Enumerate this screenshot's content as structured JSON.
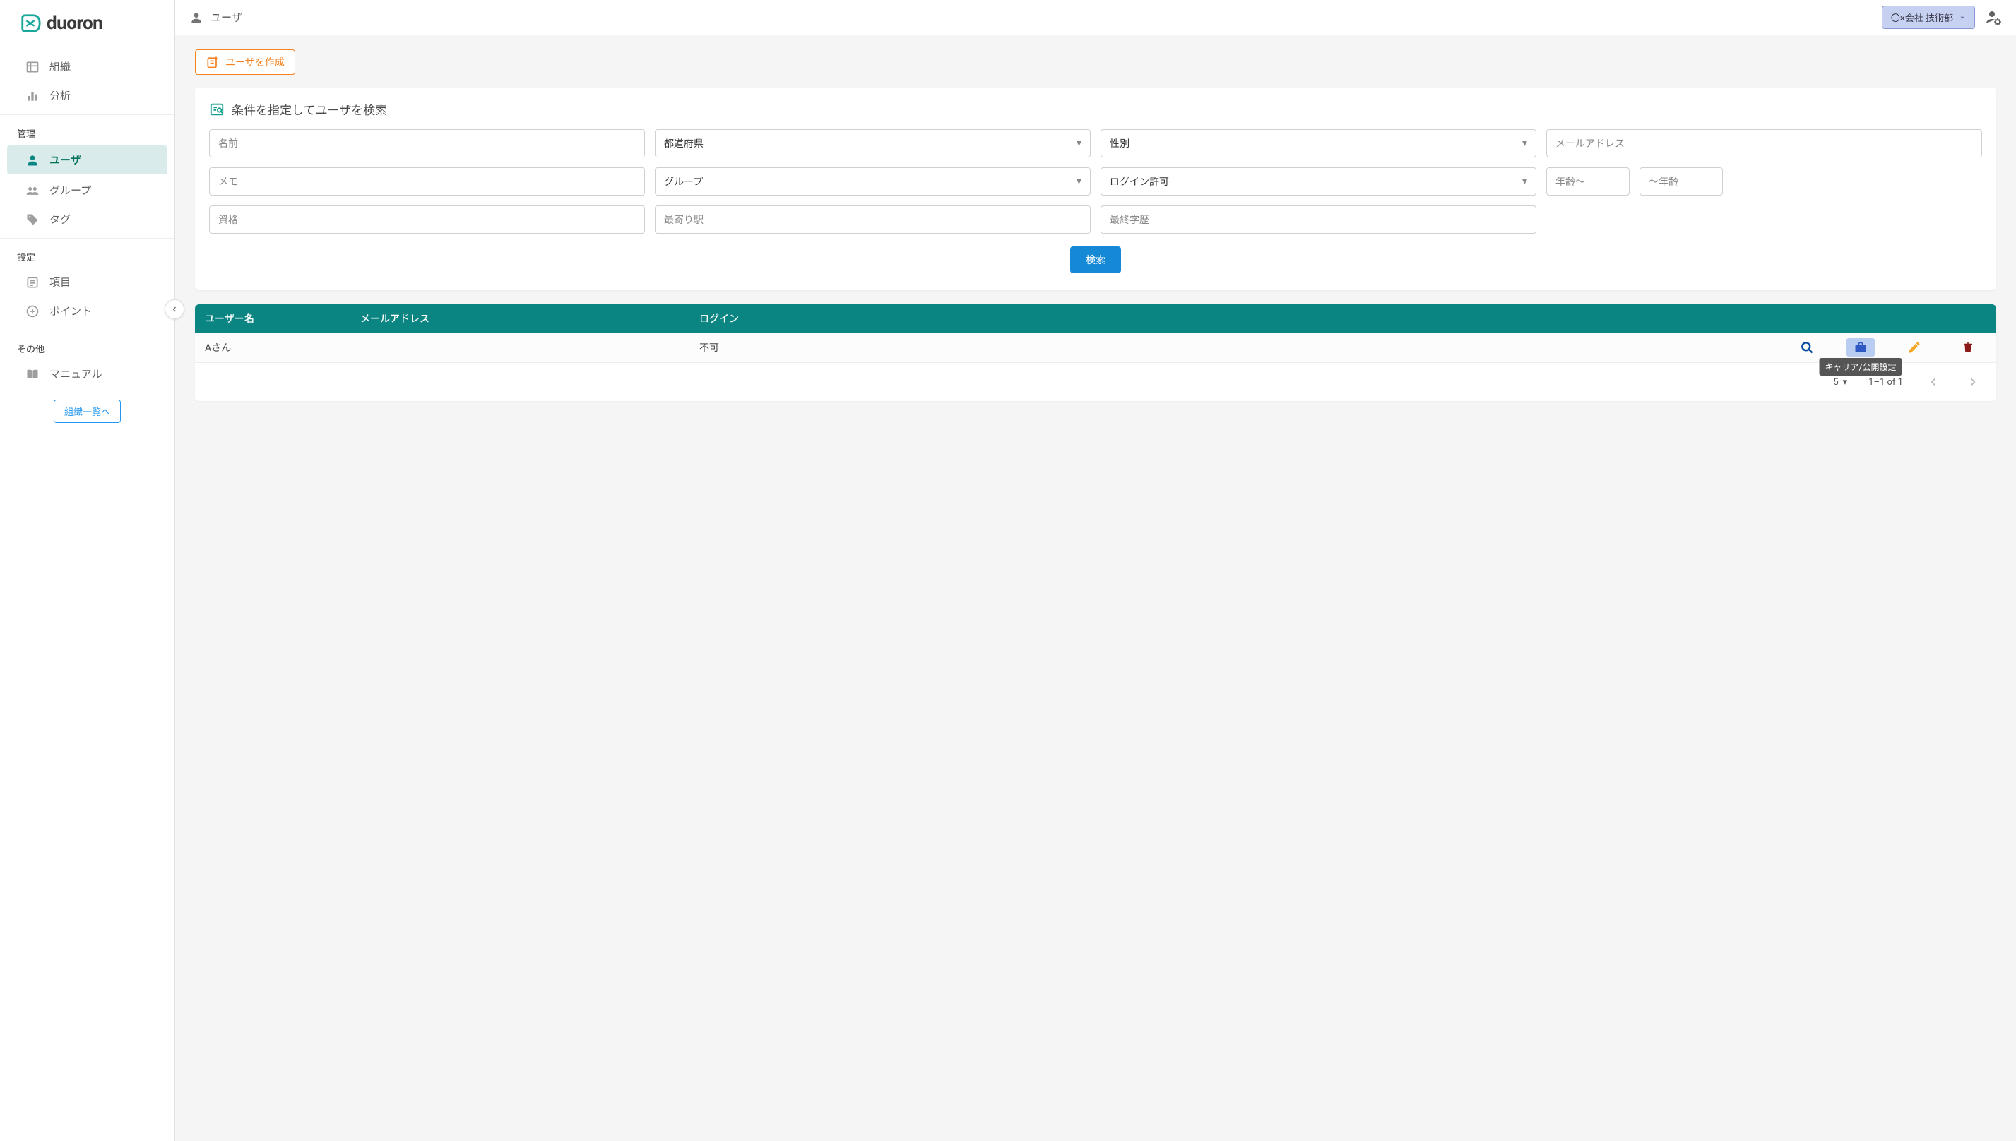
{
  "brand": "duoron",
  "topbar": {
    "title": "ユーザ",
    "org_selector": "〇×会社 技術部"
  },
  "sidebar": {
    "top_items": [
      {
        "label": "組織"
      },
      {
        "label": "分析"
      }
    ],
    "sections": [
      {
        "header": "管理",
        "items": [
          {
            "label": "ユーザ",
            "active": true
          },
          {
            "label": "グループ"
          },
          {
            "label": "タグ"
          }
        ]
      },
      {
        "header": "設定",
        "items": [
          {
            "label": "項目"
          },
          {
            "label": "ポイント"
          }
        ]
      },
      {
        "header": "その他",
        "items": [
          {
            "label": "マニュアル"
          }
        ]
      }
    ],
    "org_list_btn": "組織一覧へ"
  },
  "create_button": "ユーザを作成",
  "search": {
    "title": "条件を指定してユーザを検索",
    "fields": {
      "name": "名前",
      "prefecture": "都道府県",
      "gender": "性別",
      "email": "メールアドレス",
      "memo": "メモ",
      "group": "グループ",
      "login_allow": "ログイン許可",
      "age_from": "年齢〜",
      "age_to": "〜年齢",
      "qualification": "資格",
      "nearest_station": "最寄り駅",
      "education": "最終学歴"
    },
    "submit": "検索"
  },
  "table": {
    "headers": {
      "name": "ユーザー名",
      "email": "メールアドレス",
      "login": "ログイン"
    },
    "rows": [
      {
        "name": "Aさん",
        "email": "",
        "login": "不可"
      }
    ],
    "tooltip": "キャリア/公開設定",
    "footer": {
      "page_size": "5",
      "range": "1–1 of 1"
    }
  }
}
